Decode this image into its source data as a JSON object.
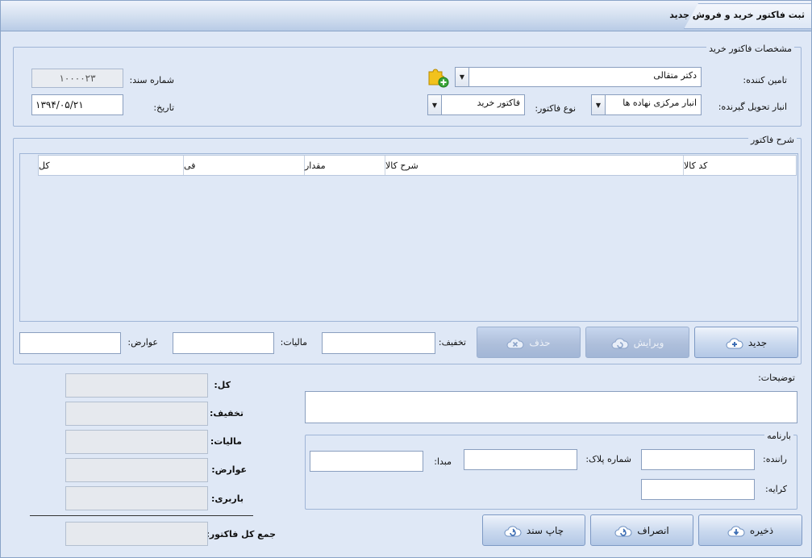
{
  "window": {
    "title": "ثبت فاکتور خرید و فروش جدید"
  },
  "invoice_group": {
    "legend": "مشخصات فاکتور خرید",
    "supplier_label": "تامین کننده:",
    "supplier_value": "دکتر متقالی",
    "warehouse_label": "انبار تحویل گیرنده:",
    "warehouse_value": "انبار مرکزی نهاده ها",
    "invoice_type_label": "نوع فاکتور:",
    "invoice_type_value": "فاکتور خرید",
    "doc_number_label": "شماره سند:",
    "doc_number_value": "۱۰۰۰۰۲۳",
    "date_label": "تاریخ:",
    "date_value": "۱۳۹۴/۰۵/۲۱",
    "add_supplier_icon": "puzzle-plus-icon"
  },
  "items_group": {
    "legend": "شرح فاکتور",
    "columns": [
      "کد کالا",
      "شرح کالا",
      "مقدار",
      "فی",
      "کل"
    ],
    "new_label": "جدید",
    "edit_label": "ویرایش",
    "delete_label": "حذف",
    "discount_label": "تخفیف:",
    "tax_label": "مالیات:",
    "duties_label": "عوارض:"
  },
  "notes": {
    "label": "توضیحات:"
  },
  "waybill": {
    "legend": "بارنامه",
    "driver_label": "راننده:",
    "plate_label": "شماره پلاک:",
    "origin_label": "مبدا:",
    "fare_label": "کرایه:"
  },
  "totals": {
    "total_label": "کل:",
    "discount_label": "تخفیف:",
    "tax_label": "مالیات:",
    "duties_label": "عوارض:",
    "freight_label": "باربری:",
    "grand_total_label": "جمع کل فاکتور:"
  },
  "actions": {
    "save_label": "ذخیره",
    "cancel_label": "انصراف",
    "print_label": "چاپ سند"
  },
  "colors": {
    "background": "#dfe8f6",
    "border": "#9fb5d6",
    "button": "#c9d8ee"
  }
}
